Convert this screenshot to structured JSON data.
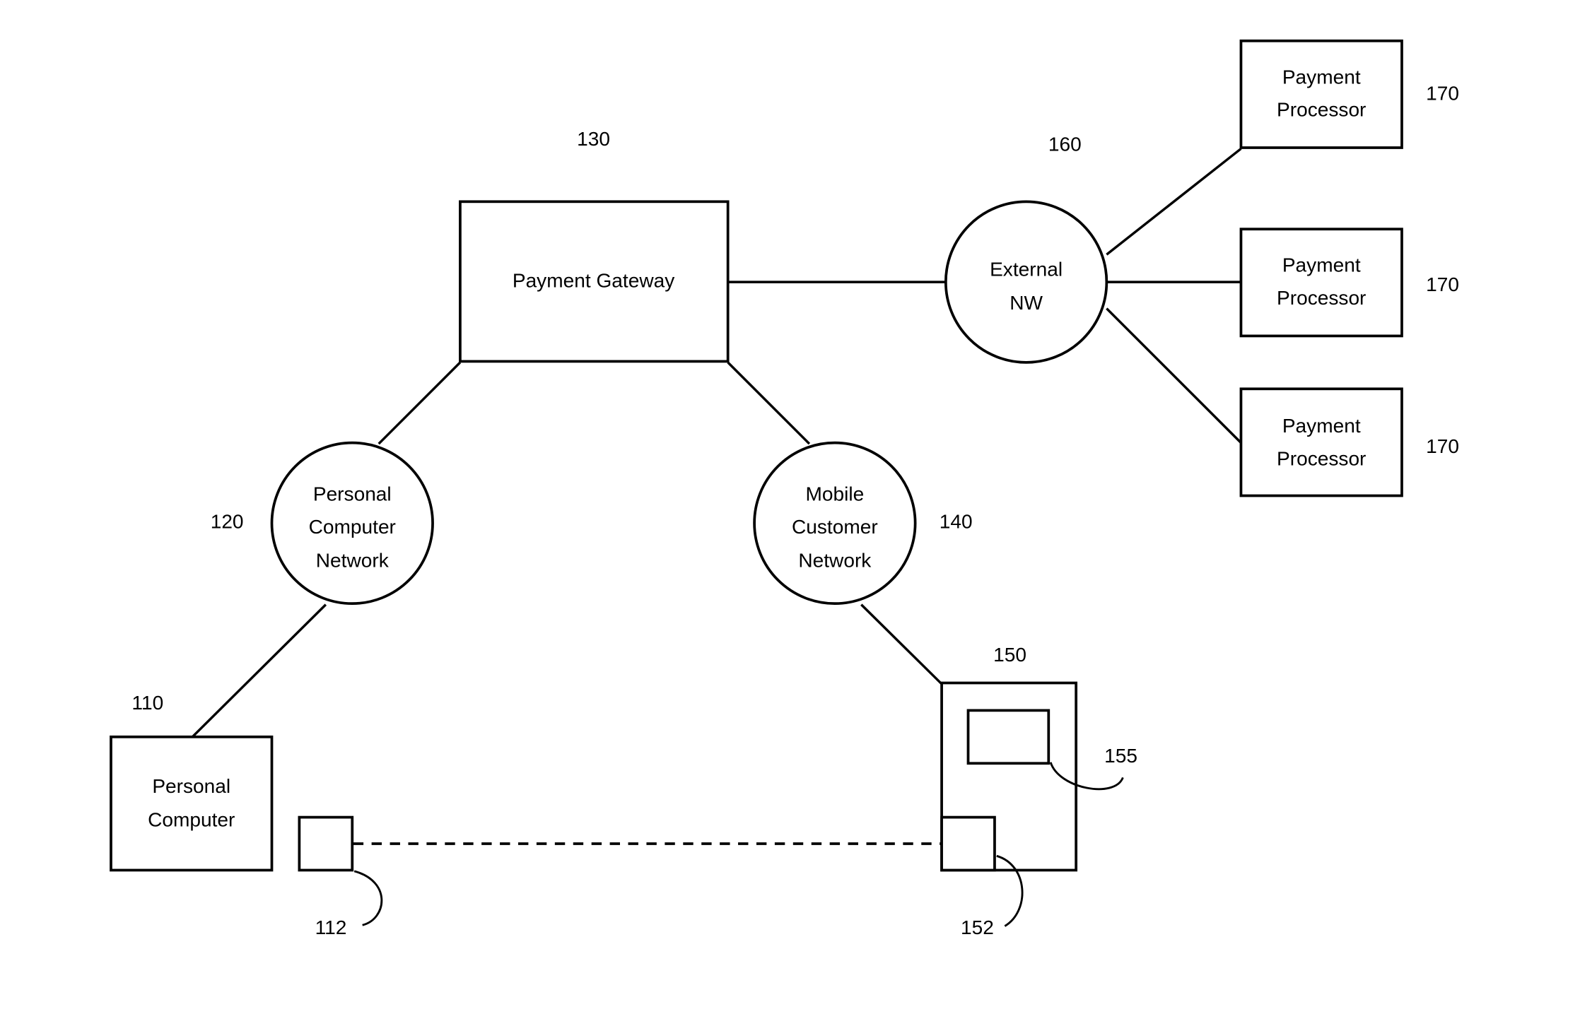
{
  "diagram": {
    "nodes": {
      "payment_gateway": {
        "ref": "130",
        "lines": [
          "Payment Gateway"
        ],
        "shape": "rectangle"
      },
      "external_nw": {
        "ref": "160",
        "lines": [
          "External",
          "NW"
        ],
        "shape": "circle"
      },
      "payment_processor_1": {
        "ref": "170",
        "lines": [
          "Payment",
          "Processor"
        ],
        "shape": "rectangle"
      },
      "payment_processor_2": {
        "ref": "170",
        "lines": [
          "Payment",
          "Processor"
        ],
        "shape": "rectangle"
      },
      "payment_processor_3": {
        "ref": "170",
        "lines": [
          "Payment",
          "Processor"
        ],
        "shape": "rectangle"
      },
      "pc_network": {
        "ref": "120",
        "lines": [
          "Personal",
          "Computer",
          "Network"
        ],
        "shape": "circle"
      },
      "mobile_network": {
        "ref": "140",
        "lines": [
          "Mobile",
          "Customer",
          "Network"
        ],
        "shape": "circle"
      },
      "personal_computer": {
        "ref": "110",
        "lines": [
          "Personal",
          "Computer"
        ],
        "shape": "rectangle"
      },
      "pc_peripheral": {
        "ref": "112",
        "lines": [],
        "shape": "square"
      },
      "mobile_device": {
        "ref": "150",
        "lines": [],
        "shape": "rectangle"
      },
      "mobile_screen": {
        "ref": "155",
        "lines": [],
        "shape": "rectangle"
      },
      "mobile_reader": {
        "ref": "152",
        "lines": [],
        "shape": "square"
      }
    },
    "edges": [
      {
        "from": "payment_gateway",
        "to": "external_nw",
        "style": "solid"
      },
      {
        "from": "external_nw",
        "to": "payment_processor_1",
        "style": "solid"
      },
      {
        "from": "external_nw",
        "to": "payment_processor_2",
        "style": "solid"
      },
      {
        "from": "external_nw",
        "to": "payment_processor_3",
        "style": "solid"
      },
      {
        "from": "payment_gateway",
        "to": "pc_network",
        "style": "solid"
      },
      {
        "from": "payment_gateway",
        "to": "mobile_network",
        "style": "solid"
      },
      {
        "from": "pc_network",
        "to": "personal_computer",
        "style": "solid"
      },
      {
        "from": "mobile_network",
        "to": "mobile_device",
        "style": "solid"
      },
      {
        "from": "pc_peripheral",
        "to": "mobile_reader",
        "style": "dashed"
      }
    ]
  }
}
